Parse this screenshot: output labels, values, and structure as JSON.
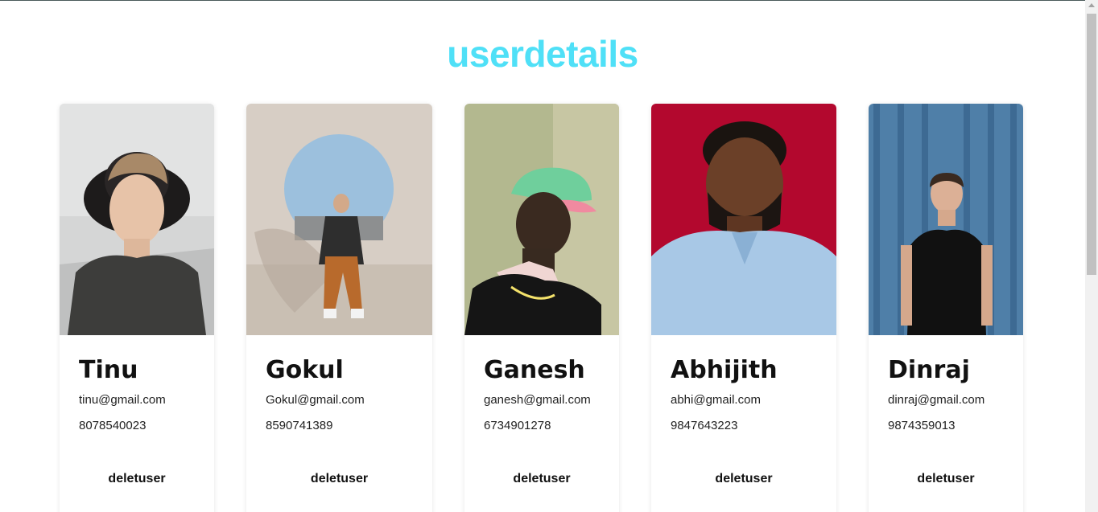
{
  "header": {
    "title": "userdetails"
  },
  "users": [
    {
      "name": "Tinu",
      "email": "tinu@gmail.com",
      "phone": "8078540023",
      "action": "deletuser"
    },
    {
      "name": "Gokul",
      "email": "Gokul@gmail.com",
      "phone": "8590741389",
      "action": "deletuser"
    },
    {
      "name": "Ganesh",
      "email": "ganesh@gmail.com",
      "phone": "6734901278",
      "action": "deletuser"
    },
    {
      "name": "Abhijith",
      "email": "abhi@gmail.com",
      "phone": "9847643223",
      "action": "deletuser"
    },
    {
      "name": "Dinraj",
      "email": "dinraj@gmail.com",
      "phone": "9874359013",
      "action": "deletuser"
    }
  ],
  "colors": {
    "title": "#4fe0f7",
    "abhijith_bg": "#b3082e",
    "dinraj_bg": "#4f7fa8"
  }
}
